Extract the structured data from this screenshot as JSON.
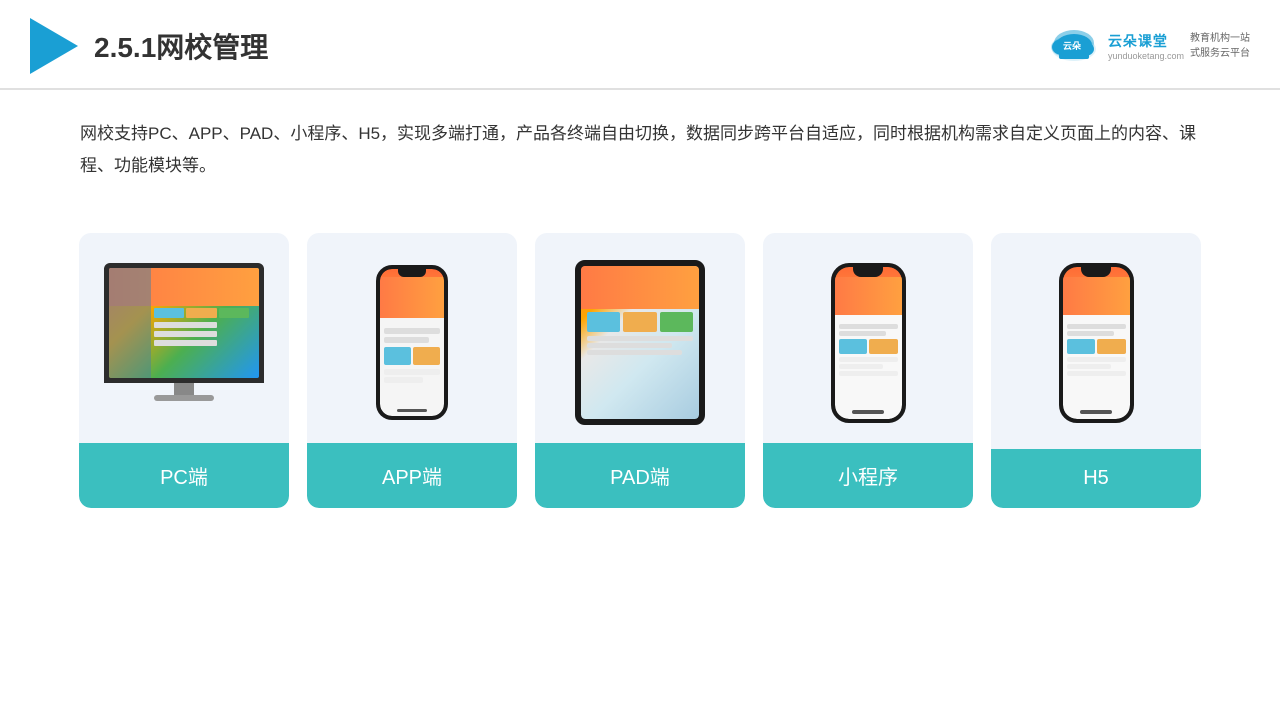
{
  "header": {
    "title": "2.5.1网校管理",
    "brand": {
      "name": "云朵课堂",
      "url": "yunduoketang.com",
      "slogan": "教育机构一站\n式服务云平台"
    }
  },
  "description": {
    "text": "网校支持PC、APP、PAD、小程序、H5，实现多端打通，产品各终端自由切换，数据同步跨平台自适应，同时根据机构需求自定义页面上的内容、课程、功能模块等。"
  },
  "cards": [
    {
      "id": "pc",
      "label": "PC端"
    },
    {
      "id": "app",
      "label": "APP端"
    },
    {
      "id": "pad",
      "label": "PAD端"
    },
    {
      "id": "miniprogram",
      "label": "小程序"
    },
    {
      "id": "h5",
      "label": "H5"
    }
  ],
  "colors": {
    "accent": "#3bbfbf",
    "header_line": "#d0d0d0",
    "text_main": "#333333",
    "card_bg": "#f0f4fa"
  }
}
